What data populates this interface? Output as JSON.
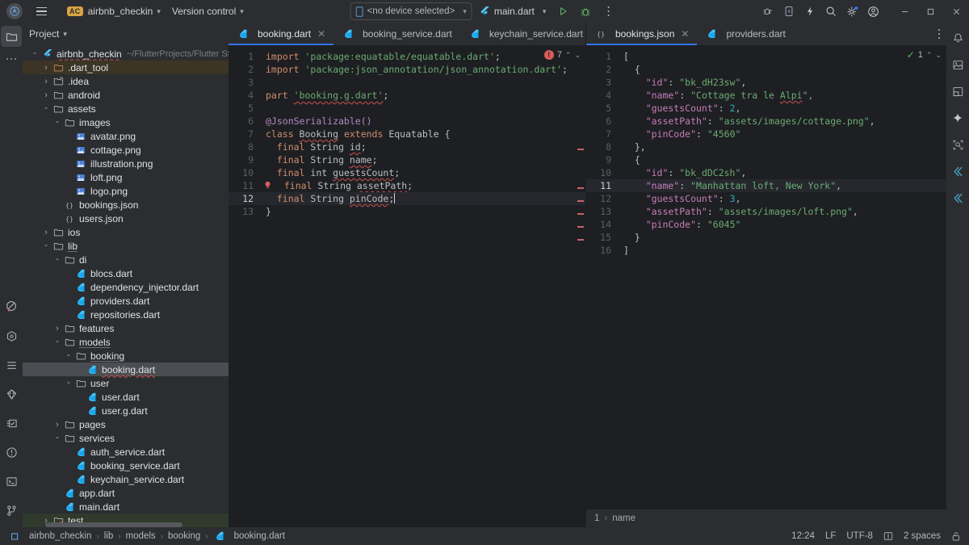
{
  "window": {
    "app_icon": "android-studio-logo-icon",
    "menu_icon": "hamburger-menu-icon",
    "project_badge": "AC",
    "project_name": "airbnb_checkin",
    "version_control": "Version control",
    "device_selector": "<no device selected>",
    "run_config": "main.dart",
    "run_icon": "run-play-icon",
    "debug_icon": "debug-bug-icon",
    "more_icon": "more-vertical-icon",
    "minimize": "—",
    "maximize": "❐",
    "close": "✕"
  },
  "toolbar_right_icons": [
    {
      "name": "device-manager-bug-icon"
    },
    {
      "name": "device-phone-icon"
    },
    {
      "name": "flash-updates-icon"
    },
    {
      "name": "search-icon"
    },
    {
      "name": "settings-gear-icon"
    },
    {
      "name": "user-account-icon"
    }
  ],
  "left_rail": {
    "top": [
      {
        "name": "project-tool-icon",
        "active": true
      },
      {
        "name": "more-tools-dots-icon",
        "active": false
      }
    ],
    "bottom": [
      {
        "name": "flutter-inspector-icon"
      },
      {
        "name": "flutter-outline-icon"
      },
      {
        "name": "structure-icon"
      },
      {
        "name": "dart-analysis-icon"
      },
      {
        "name": "todo-icon"
      },
      {
        "name": "problems-icon"
      },
      {
        "name": "terminal-icon"
      },
      {
        "name": "version-control-branch-icon"
      }
    ]
  },
  "right_rail": [
    {
      "name": "notifications-bell-icon"
    },
    {
      "name": "gradle-icon"
    },
    {
      "name": "resource-manager-icon"
    },
    {
      "name": "gemini-ai-icon"
    },
    {
      "name": "layout-inspector-icon"
    },
    {
      "name": "flutter-performance-icon"
    },
    {
      "name": "flutter-devtools-icon"
    }
  ],
  "project_panel": {
    "title": "Project",
    "chevron": "⌄",
    "tree": [
      {
        "indent": 0,
        "arrow": "down",
        "icon": "flutter-project-icon",
        "label": "airbnb_checkin",
        "path": "~/FlutterProjects/Flutter State M",
        "style": "ul-wavy",
        "state": "normal"
      },
      {
        "indent": 1,
        "arrow": "right",
        "icon": "folder-excluded-icon",
        "label": ".dart_tool",
        "path": "",
        "style": "plain",
        "state": "highlight"
      },
      {
        "indent": 1,
        "arrow": "right",
        "icon": "folder-idea-icon",
        "label": ".idea",
        "path": "",
        "style": "plain",
        "state": "normal"
      },
      {
        "indent": 1,
        "arrow": "right",
        "icon": "folder-icon",
        "label": "android",
        "path": "",
        "style": "plain",
        "state": "normal"
      },
      {
        "indent": 1,
        "arrow": "down",
        "icon": "folder-icon",
        "label": "assets",
        "path": "",
        "style": "plain",
        "state": "normal"
      },
      {
        "indent": 2,
        "arrow": "down",
        "icon": "folder-icon",
        "label": "images",
        "path": "",
        "style": "plain",
        "state": "normal"
      },
      {
        "indent": 3,
        "arrow": "none",
        "icon": "image-file-icon",
        "label": "avatar.png",
        "path": "",
        "style": "plain",
        "state": "normal"
      },
      {
        "indent": 3,
        "arrow": "none",
        "icon": "image-file-icon",
        "label": "cottage.png",
        "path": "",
        "style": "plain",
        "state": "normal"
      },
      {
        "indent": 3,
        "arrow": "none",
        "icon": "image-file-icon",
        "label": "illustration.png",
        "path": "",
        "style": "plain",
        "state": "normal"
      },
      {
        "indent": 3,
        "arrow": "none",
        "icon": "image-file-icon",
        "label": "loft.png",
        "path": "",
        "style": "plain",
        "state": "normal"
      },
      {
        "indent": 3,
        "arrow": "none",
        "icon": "image-file-icon",
        "label": "logo.png",
        "path": "",
        "style": "plain",
        "state": "normal"
      },
      {
        "indent": 2,
        "arrow": "none",
        "icon": "json-file-icon",
        "label": "bookings.json",
        "path": "",
        "style": "plain",
        "state": "normal"
      },
      {
        "indent": 2,
        "arrow": "none",
        "icon": "json-file-icon",
        "label": "users.json",
        "path": "",
        "style": "plain",
        "state": "normal"
      },
      {
        "indent": 1,
        "arrow": "right",
        "icon": "folder-icon",
        "label": "ios",
        "path": "",
        "style": "plain",
        "state": "normal"
      },
      {
        "indent": 1,
        "arrow": "down",
        "icon": "folder-icon",
        "label": "lib",
        "path": "",
        "style": "ul",
        "state": "normal"
      },
      {
        "indent": 2,
        "arrow": "down",
        "icon": "folder-icon",
        "label": "di",
        "path": "",
        "style": "plain",
        "state": "normal"
      },
      {
        "indent": 3,
        "arrow": "none",
        "icon": "dart-file-icon",
        "label": "blocs.dart",
        "path": "",
        "style": "plain",
        "state": "normal"
      },
      {
        "indent": 3,
        "arrow": "none",
        "icon": "dart-file-icon",
        "label": "dependency_injector.dart",
        "path": "",
        "style": "plain",
        "state": "normal"
      },
      {
        "indent": 3,
        "arrow": "none",
        "icon": "dart-file-icon",
        "label": "providers.dart",
        "path": "",
        "style": "plain",
        "state": "normal"
      },
      {
        "indent": 3,
        "arrow": "none",
        "icon": "dart-file-icon",
        "label": "repositories.dart",
        "path": "",
        "style": "plain",
        "state": "normal"
      },
      {
        "indent": 2,
        "arrow": "right",
        "icon": "folder-icon",
        "label": "features",
        "path": "",
        "style": "plain",
        "state": "normal"
      },
      {
        "indent": 2,
        "arrow": "down",
        "icon": "folder-icon",
        "label": "models",
        "path": "",
        "style": "ul",
        "state": "normal"
      },
      {
        "indent": 3,
        "arrow": "down",
        "icon": "folder-icon",
        "label": "booking",
        "path": "",
        "style": "ul",
        "state": "normal"
      },
      {
        "indent": 4,
        "arrow": "none",
        "icon": "dart-file-icon",
        "label": "booking.dart",
        "path": "",
        "style": "ul-wavy",
        "state": "selected"
      },
      {
        "indent": 3,
        "arrow": "down",
        "icon": "folder-icon",
        "label": "user",
        "path": "",
        "style": "plain",
        "state": "normal"
      },
      {
        "indent": 4,
        "arrow": "none",
        "icon": "dart-file-icon",
        "label": "user.dart",
        "path": "",
        "style": "plain",
        "state": "normal"
      },
      {
        "indent": 4,
        "arrow": "none",
        "icon": "dart-file-icon",
        "label": "user.g.dart",
        "path": "",
        "style": "plain",
        "state": "normal"
      },
      {
        "indent": 2,
        "arrow": "right",
        "icon": "folder-icon",
        "label": "pages",
        "path": "",
        "style": "plain",
        "state": "normal"
      },
      {
        "indent": 2,
        "arrow": "down",
        "icon": "folder-icon",
        "label": "services",
        "path": "",
        "style": "plain",
        "state": "normal"
      },
      {
        "indent": 3,
        "arrow": "none",
        "icon": "dart-file-icon",
        "label": "auth_service.dart",
        "path": "",
        "style": "plain",
        "state": "normal"
      },
      {
        "indent": 3,
        "arrow": "none",
        "icon": "dart-file-icon",
        "label": "booking_service.dart",
        "path": "",
        "style": "plain",
        "state": "normal"
      },
      {
        "indent": 3,
        "arrow": "none",
        "icon": "dart-file-icon",
        "label": "keychain_service.dart",
        "path": "",
        "style": "plain",
        "state": "normal"
      },
      {
        "indent": 2,
        "arrow": "none",
        "icon": "dart-file-icon",
        "label": "app.dart",
        "path": "",
        "style": "plain",
        "state": "normal"
      },
      {
        "indent": 2,
        "arrow": "none",
        "icon": "dart-file-icon",
        "label": "main.dart",
        "path": "",
        "style": "plain",
        "state": "normal"
      },
      {
        "indent": 1,
        "arrow": "right",
        "icon": "folder-test-icon",
        "label": "test",
        "path": "",
        "style": "wavy",
        "state": "green"
      }
    ]
  },
  "left_editor": {
    "tabs": [
      {
        "label": "booking.dart",
        "icon": "dart-file-icon",
        "active": true,
        "closable": true
      },
      {
        "label": "booking_service.dart",
        "icon": "dart-file-icon",
        "active": false,
        "closable": false
      },
      {
        "label": "keychain_service.dart",
        "icon": "dart-file-icon",
        "active": false,
        "closable": false
      }
    ],
    "inspection": {
      "error_count": "7",
      "up": "⌃",
      "down": "⌄"
    },
    "cursor_line": 12,
    "lines": [
      {
        "n": 1,
        "tokens": [
          {
            "t": "import ",
            "c": "kw"
          },
          {
            "t": "'package:equatable/equatable.dart'",
            "c": "str"
          },
          {
            "t": ";",
            "c": "pln"
          }
        ]
      },
      {
        "n": 2,
        "tokens": [
          {
            "t": "import ",
            "c": "kw"
          },
          {
            "t": "'package:json_annotation/json_annotation.dart'",
            "c": "str"
          },
          {
            "t": ";",
            "c": "pln"
          }
        ]
      },
      {
        "n": 3,
        "tokens": []
      },
      {
        "n": 4,
        "tokens": [
          {
            "t": "part ",
            "c": "kw"
          },
          {
            "t": "'booking.g.dart'",
            "c": "lnk"
          },
          {
            "t": ";",
            "c": "pln"
          }
        ]
      },
      {
        "n": 5,
        "tokens": []
      },
      {
        "n": 6,
        "tokens": [
          {
            "t": "@JsonSerializable()",
            "c": "ann"
          }
        ]
      },
      {
        "n": 7,
        "tokens": [
          {
            "t": "class ",
            "c": "kw"
          },
          {
            "t": "Booking",
            "c": "err"
          },
          {
            "t": " extends ",
            "c": "kw"
          },
          {
            "t": "Equatable {",
            "c": "pln"
          }
        ]
      },
      {
        "n": 8,
        "tokens": [
          {
            "t": "  final ",
            "c": "kw"
          },
          {
            "t": "String ",
            "c": "pln"
          },
          {
            "t": "id",
            "c": "err"
          },
          {
            "t": ";",
            "c": "pln"
          }
        ]
      },
      {
        "n": 9,
        "tokens": [
          {
            "t": "  final ",
            "c": "kw"
          },
          {
            "t": "String ",
            "c": "pln"
          },
          {
            "t": "name",
            "c": "err"
          },
          {
            "t": ";",
            "c": "pln"
          }
        ]
      },
      {
        "n": 10,
        "tokens": [
          {
            "t": "  final ",
            "c": "kw"
          },
          {
            "t": "int ",
            "c": "pln"
          },
          {
            "t": "guestsCount",
            "c": "err"
          },
          {
            "t": ";",
            "c": "pln"
          }
        ]
      },
      {
        "n": 11,
        "tokens": [
          {
            "t": "  final ",
            "c": "kw"
          },
          {
            "t": "String ",
            "c": "pln"
          },
          {
            "t": "assetPath",
            "c": "err"
          },
          {
            "t": ";",
            "c": "pln"
          }
        ],
        "bulb": true
      },
      {
        "n": 12,
        "tokens": [
          {
            "t": "  final ",
            "c": "kw"
          },
          {
            "t": "String ",
            "c": "pln"
          },
          {
            "t": "pinCode",
            "c": "err"
          },
          {
            "t": ";",
            "c": "pln"
          }
        ],
        "caret": true
      },
      {
        "n": 13,
        "tokens": [
          {
            "t": "}",
            "c": "pln"
          }
        ]
      }
    ]
  },
  "right_editor": {
    "tabs": [
      {
        "label": "bookings.json",
        "icon": "json-file-icon",
        "active": true,
        "closable": true
      },
      {
        "label": "providers.dart",
        "icon": "dart-file-icon",
        "active": false,
        "closable": false
      }
    ],
    "inspection": {
      "ok_count": "1",
      "up": "⌃",
      "down": "⌄"
    },
    "cursor_line": 11,
    "breadcrumb": {
      "index": "1",
      "sep": "›",
      "field": "name"
    },
    "lines": [
      {
        "n": 1,
        "tokens": [
          {
            "t": "[",
            "c": "pln"
          }
        ]
      },
      {
        "n": 2,
        "tokens": [
          {
            "t": "  {",
            "c": "pln"
          }
        ]
      },
      {
        "n": 3,
        "tokens": [
          {
            "t": "    \"id\"",
            "c": "jkey"
          },
          {
            "t": ": ",
            "c": "pln"
          },
          {
            "t": "\"bk_dH23sw\"",
            "c": "str"
          },
          {
            "t": ",",
            "c": "pln"
          }
        ]
      },
      {
        "n": 4,
        "tokens": [
          {
            "t": "    \"name\"",
            "c": "jkey"
          },
          {
            "t": ": ",
            "c": "pln"
          },
          {
            "t": "\"Cottage tra le ",
            "c": "str"
          },
          {
            "t": "Alpi",
            "c": "strerr"
          },
          {
            "t": "\",",
            "c": "str"
          }
        ]
      },
      {
        "n": 5,
        "tokens": [
          {
            "t": "    \"guestsCount\"",
            "c": "jkey"
          },
          {
            "t": ": ",
            "c": "pln"
          },
          {
            "t": "2",
            "c": "num"
          },
          {
            "t": ",",
            "c": "pln"
          }
        ]
      },
      {
        "n": 6,
        "tokens": [
          {
            "t": "    \"assetPath\"",
            "c": "jkey"
          },
          {
            "t": ": ",
            "c": "pln"
          },
          {
            "t": "\"assets/images/cottage.png\"",
            "c": "str"
          },
          {
            "t": ",",
            "c": "pln"
          }
        ]
      },
      {
        "n": 7,
        "tokens": [
          {
            "t": "    \"pinCode\"",
            "c": "jkey"
          },
          {
            "t": ": ",
            "c": "pln"
          },
          {
            "t": "\"4560\"",
            "c": "str"
          }
        ]
      },
      {
        "n": 8,
        "tokens": [
          {
            "t": "  },",
            "c": "pln"
          }
        ]
      },
      {
        "n": 9,
        "tokens": [
          {
            "t": "  {",
            "c": "pln"
          }
        ]
      },
      {
        "n": 10,
        "tokens": [
          {
            "t": "    \"id\"",
            "c": "jkey"
          },
          {
            "t": ": ",
            "c": "pln"
          },
          {
            "t": "\"bk_dDC2sh\"",
            "c": "str"
          },
          {
            "t": ",",
            "c": "pln"
          }
        ]
      },
      {
        "n": 11,
        "tokens": [
          {
            "t": "    \"name\"",
            "c": "jkey"
          },
          {
            "t": ": ",
            "c": "pln"
          },
          {
            "t": "\"Manhattan loft, New York\"",
            "c": "str"
          },
          {
            "t": ",",
            "c": "pln"
          }
        ]
      },
      {
        "n": 12,
        "tokens": [
          {
            "t": "    \"guestsCount\"",
            "c": "jkey"
          },
          {
            "t": ": ",
            "c": "pln"
          },
          {
            "t": "3",
            "c": "num"
          },
          {
            "t": ",",
            "c": "pln"
          }
        ]
      },
      {
        "n": 13,
        "tokens": [
          {
            "t": "    \"assetPath\"",
            "c": "jkey"
          },
          {
            "t": ": ",
            "c": "pln"
          },
          {
            "t": "\"assets/images/loft.png\"",
            "c": "str"
          },
          {
            "t": ",",
            "c": "pln"
          }
        ]
      },
      {
        "n": 14,
        "tokens": [
          {
            "t": "    \"pinCode\"",
            "c": "jkey"
          },
          {
            "t": ": ",
            "c": "pln"
          },
          {
            "t": "\"6045\"",
            "c": "str"
          }
        ]
      },
      {
        "n": 15,
        "tokens": [
          {
            "t": "  }",
            "c": "pln"
          }
        ]
      },
      {
        "n": 16,
        "tokens": [
          {
            "t": "]",
            "c": "pln"
          }
        ]
      }
    ]
  },
  "status_bar": {
    "breadcrumb": [
      {
        "label": "airbnb_checkin",
        "icon": "module-icon"
      },
      {
        "label": "lib",
        "icon": ""
      },
      {
        "label": "models",
        "icon": ""
      },
      {
        "label": "booking",
        "icon": ""
      },
      {
        "label": "booking.dart",
        "icon": "dart-file-icon"
      }
    ],
    "separator": "›",
    "caret_position": "12:24",
    "line_separator": "LF",
    "encoding": "UTF-8",
    "reader_mode_icon": "reader-mode-icon",
    "indent": "2 spaces",
    "lock_icon": "unlocked-icon"
  },
  "colors": {
    "accent_blue": "#3574f0",
    "badge_orange": "#d9a343",
    "error_red": "#db5c5c",
    "ok_green": "#5fb865",
    "string_green": "#6aab73",
    "keyword_orange": "#cf8e6d",
    "bg_editor": "#1e1f22",
    "bg_panel": "#2b2d30"
  }
}
